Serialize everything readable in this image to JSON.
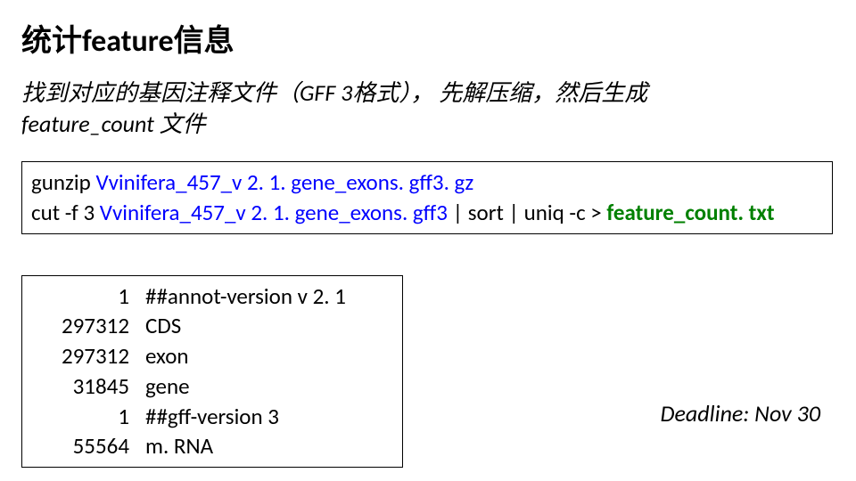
{
  "title": "统计feature信息",
  "subtitle_line1": "找到对应的基因注释文件（GFF 3格式）， 先解压缩，然后生成",
  "subtitle_line2": "feature_count 文件",
  "commands": {
    "line1_pre": "gunzip ",
    "line1_file": "Vvinifera_457_v 2. 1. gene_exons. gff3. gz",
    "line2_pre": "cut -f 3 ",
    "line2_file": "Vvinifera_457_v 2. 1. gene_exons. gff3 ",
    "line2_mid": "| sort | uniq -c > ",
    "line2_out": "feature_count. txt"
  },
  "output": [
    {
      "count": "1",
      "label": "##annot-version v 2. 1"
    },
    {
      "count": "297312",
      "label": "CDS"
    },
    {
      "count": "297312",
      "label": "exon"
    },
    {
      "count": "31845",
      "label": "gene"
    },
    {
      "count": "1",
      "label": "##gff-version 3"
    },
    {
      "count": "55564",
      "label": "m. RNA"
    }
  ],
  "deadline": "Deadline: Nov 30"
}
